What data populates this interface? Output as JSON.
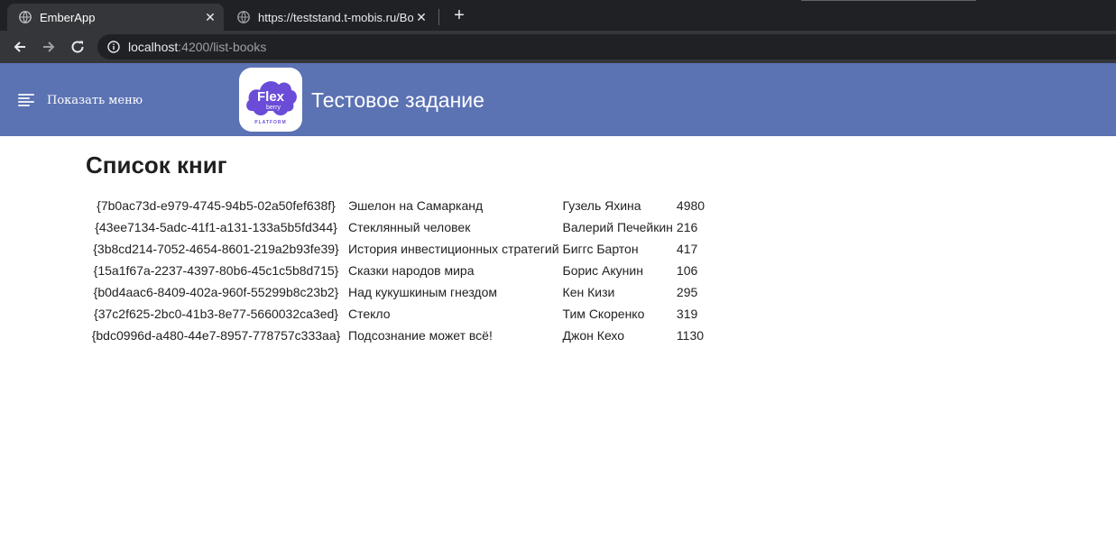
{
  "browser": {
    "tabs": [
      {
        "title": "EmberApp",
        "active": true
      },
      {
        "title": "https://teststand.t-mobis.ru/Book",
        "active": false
      }
    ],
    "address": {
      "host": "localhost",
      "path": ":4200/list-books"
    }
  },
  "header": {
    "menu_label": "Показать меню",
    "logo_text": {
      "main": "Flex",
      "sub": "berry",
      "platform": "PLATFORM"
    },
    "title": "Тестовое задание"
  },
  "page": {
    "title": "Список книг",
    "books": [
      {
        "id": "{7b0ac73d-e979-4745-94b5-02a50fef638f}",
        "title": "Эшелон на Самарканд",
        "author": "Гузель Яхина",
        "pages": "4980"
      },
      {
        "id": "{43ee7134-5adc-41f1-a131-133a5b5fd344}",
        "title": "Стеклянный человек",
        "author": "Валерий Печейкин",
        "pages": "216"
      },
      {
        "id": "{3b8cd214-7052-4654-8601-219a2b93fe39}",
        "title": "История инвестиционных стратегий",
        "author": "Биггс Бартон",
        "pages": "417"
      },
      {
        "id": "{15a1f67a-2237-4397-80b6-45c1c5b8d715}",
        "title": "Сказки народов мира",
        "author": "Борис Акунин",
        "pages": "106"
      },
      {
        "id": "{b0d4aac6-8409-402a-960f-55299b8c23b2}",
        "title": "Над кукушкиным гнездом",
        "author": "Кен Кизи",
        "pages": "295"
      },
      {
        "id": "{37c2f625-2bc0-41b3-8e77-5660032ca3ed}",
        "title": "Стекло",
        "author": "Тим Скоренко",
        "pages": "319"
      },
      {
        "id": "{bdc0996d-a480-44e7-8957-778757c333aa}",
        "title": "Подсознание может всё!",
        "author": "Джон Кехо",
        "pages": "1130"
      }
    ]
  },
  "colors": {
    "header_bg": "#5b72b3",
    "logo_purple": "#6a4cd9",
    "chrome_dark": "#202124",
    "chrome_toolbar": "#35363a"
  }
}
